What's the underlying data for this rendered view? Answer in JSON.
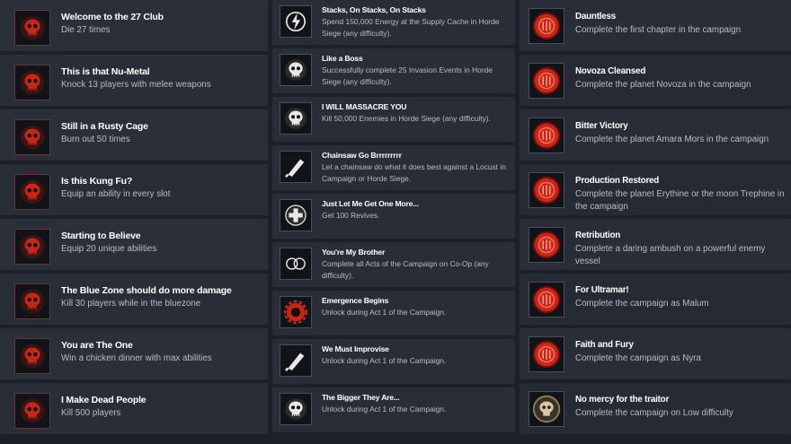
{
  "columns": [
    {
      "id": "col1",
      "items": [
        {
          "icon": "skull-crest-icon",
          "title": "Welcome to the 27 Club",
          "desc": "Die 27 times"
        },
        {
          "icon": "crossed-bat-icon",
          "title": "This is that Nu-Metal",
          "desc": "Knock 13 players with melee weapons"
        },
        {
          "icon": "flaming-skull-icon",
          "title": "Still in a Rusty Cage",
          "desc": "Burn out 50 times"
        },
        {
          "icon": "fist-icon",
          "title": "Is this Kung Fu?",
          "desc": "Equip an ability in every slot"
        },
        {
          "icon": "raised-fist-icon",
          "title": "Starting to Believe",
          "desc": "Equip 20 unique abilities"
        },
        {
          "icon": "radiation-skull-icon",
          "title": "The Blue Zone should do more damage",
          "desc": "Kill 30 players while in the bluezone"
        },
        {
          "icon": "chicken-dinner-icon",
          "title": "You are The One",
          "desc": "Win a chicken dinner with max abilities"
        },
        {
          "icon": "grim-skull-icon",
          "title": "I Make Dead People",
          "desc": "Kill 500 players"
        }
      ]
    },
    {
      "id": "col2",
      "items": [
        {
          "icon": "energy-bolt-icon",
          "title": "Stacks, On Stacks, On Stacks",
          "desc": "Spend 150,000 Energy at the Supply Cache in Horde Siege (any difficulty)."
        },
        {
          "icon": "skull-crossbones-icon",
          "title": "Like a Boss",
          "desc": "Successfully complete 25 Invasion Events in Horde Siege (any difficulty)."
        },
        {
          "icon": "skull-cog-icon",
          "title": "I WILL MASSACRE YOU",
          "desc": "Kill 50,000 Enemies in Horde Siege (any difficulty)."
        },
        {
          "icon": "chainsaw-icon",
          "title": "Chainsaw Go Brrrrrrrrr",
          "desc": "Let a chainsaw do what it does best against a Locust in Campaign or Horde Siege."
        },
        {
          "icon": "medic-cross-icon",
          "title": "Just Let Me Get One More...",
          "desc": "Get 100 Revives."
        },
        {
          "icon": "linked-circles-icon",
          "title": "You're My Brother",
          "desc": "Complete all Acts of the Campaign on Co-Op (any difficulty)."
        },
        {
          "icon": "cog-emblem-icon",
          "title": "Emergence Begins",
          "desc": "Unlock during Act 1 of the Campaign."
        },
        {
          "icon": "blade-icon",
          "title": "We Must Improvise",
          "desc": "Unlock during Act 1 of the Campaign."
        },
        {
          "icon": "locust-skull-icon",
          "title": "The Bigger They Are...",
          "desc": "Unlock during Act 1 of the Campaign."
        }
      ]
    },
    {
      "id": "col3",
      "items": [
        {
          "icon": "red-seal-icon",
          "title": "Dauntless",
          "desc": "Complete the first chapter in the campaign"
        },
        {
          "icon": "red-seal-icon",
          "title": "Novoza Cleansed",
          "desc": "Complete the planet Novoza in the campaign"
        },
        {
          "icon": "red-seal-icon",
          "title": "Bitter Victory",
          "desc": "Complete the planet Amara Mors in the campaign"
        },
        {
          "icon": "red-seal-icon",
          "title": "Production Restored",
          "desc": "Complete the planet Erythine or the moon Trephine in the campaign"
        },
        {
          "icon": "red-seal-icon",
          "title": "Retribution",
          "desc": "Complete a daring ambush on a powerful enemy vessel"
        },
        {
          "icon": "red-seal-icon",
          "title": "For Ultramar!",
          "desc": "Complete the campaign as Malum"
        },
        {
          "icon": "red-seal-icon",
          "title": "Faith and Fury",
          "desc": "Complete the campaign as Nyra"
        },
        {
          "icon": "skull-medallion-icon",
          "title": "No mercy for the traitor",
          "desc": "Complete the campaign on Low difficulty"
        }
      ]
    }
  ],
  "colors": {
    "background": "#1d2028",
    "card": "#292d38",
    "title": "#ffffff",
    "desc": "#b9bcc6",
    "seal_red": "#b51c12"
  }
}
